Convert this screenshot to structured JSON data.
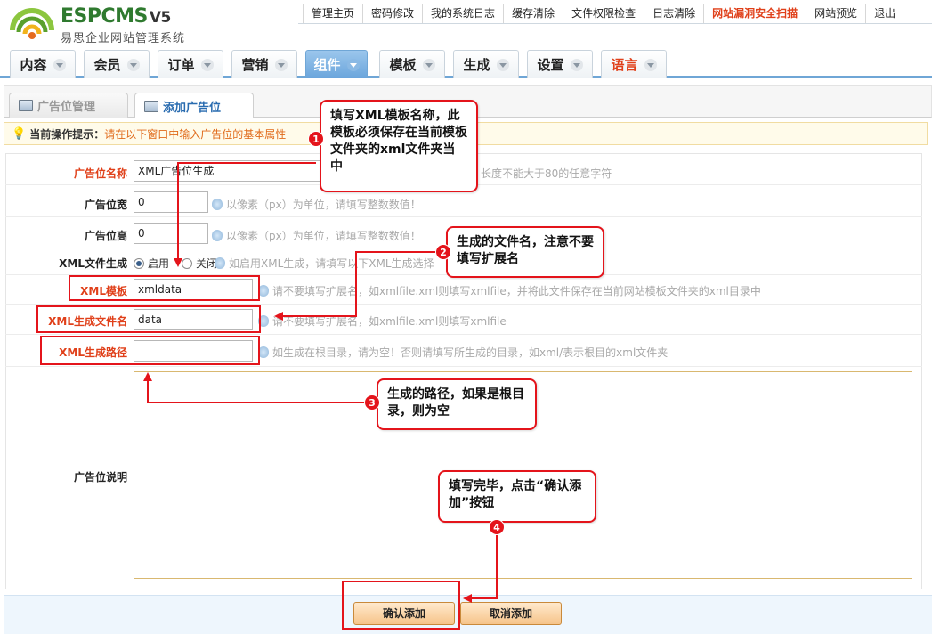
{
  "brand": {
    "name": "ESPCMS",
    "version": "V5",
    "subtitle": "易思企业网站管理系统"
  },
  "topnav": [
    "管理主页",
    "密码修改",
    "我的系统日志",
    "缓存清除",
    "文件权限检查",
    "日志清除",
    "网站漏洞安全扫描",
    "网站预览",
    "退出"
  ],
  "mainnav": [
    "内容",
    "会员",
    "订单",
    "营销",
    "组件",
    "模板",
    "生成",
    "设置",
    "语言"
  ],
  "tabs": {
    "manage": "广告位管理",
    "add": "添加广告位"
  },
  "tip": {
    "label": "当前操作提示：",
    "text": "请在以下窗口中输入广告位的基本属性"
  },
  "form": {
    "name_label": "广告位名称",
    "name_value": "XML广告位生成",
    "name_hint": "长度不能大于80的任意字符",
    "width_label": "广告位宽",
    "width_value": "0",
    "width_hint": "以像素（px）为单位，请填写整数数值！",
    "height_label": "广告位高",
    "height_value": "0",
    "height_hint": "以像素（px）为单位，请填写整数数值！",
    "xml_label": "XML文件生成",
    "xml_on": "启用",
    "xml_off": "关闭",
    "xml_hint": "如启用XML生成，请填写以下XML生成选择",
    "tpl_label": "XML模板",
    "tpl_value": "xmldata",
    "tpl_hint": "请不要填写扩展名，如xmlfile.xml则填写xmlfile，并将此文件保存在当前网站模板文件夹的xml目录中",
    "file_label": "XML生成文件名",
    "file_value": "data",
    "file_hint": "请不要填写扩展名，如xmlfile.xml则填写xmlfile",
    "path_label": "XML生成路径",
    "path_value": "",
    "path_hint": "如生成在根目录，请为空！否则请填写所生成的目录，如xml/表示根目的xml文件夹",
    "desc_label": "广告位说明"
  },
  "buttons": {
    "confirm": "确认添加",
    "cancel": "取消添加"
  },
  "callouts": [
    {
      "num": "1",
      "text": "填写XML模板名称，此模板必须保存在当前模板文件夹的xml文件夹当中"
    },
    {
      "num": "2",
      "text": "生成的文件名，注意不要填写扩展名"
    },
    {
      "num": "3",
      "text": "生成的路径，如果是根目录，则为空"
    },
    {
      "num": "4",
      "text": "填写完毕，点击“确认添加”按钮"
    }
  ],
  "colors": {
    "annotation": "#e4141b",
    "required": "#e0401a",
    "nav_active": "#6fa6d6"
  }
}
